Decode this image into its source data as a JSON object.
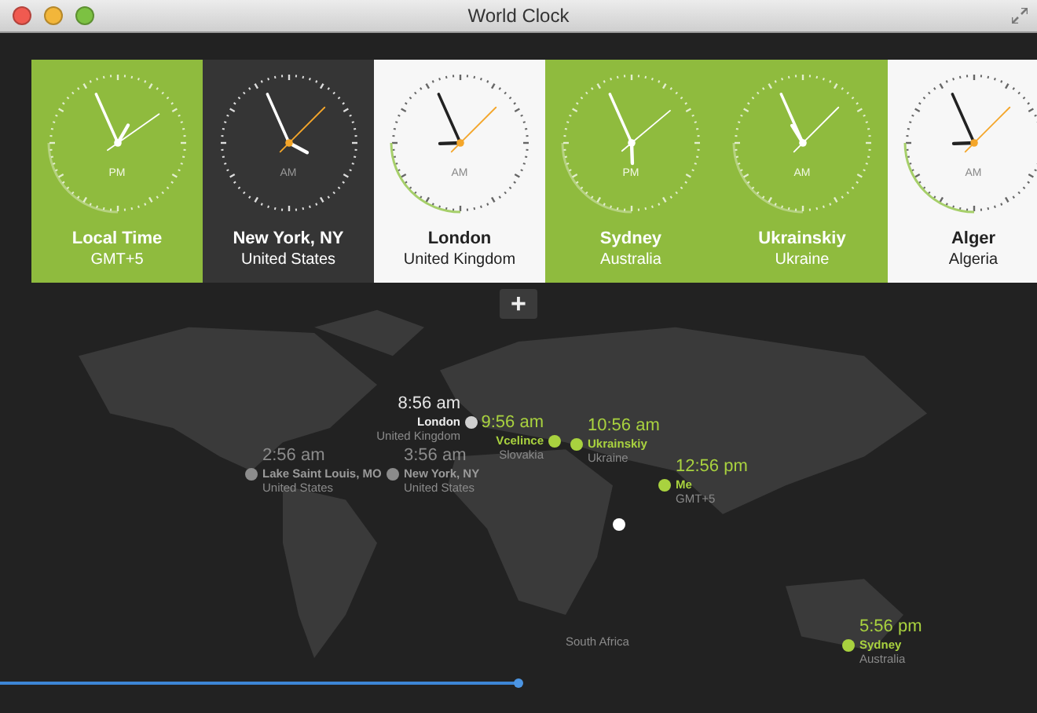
{
  "window": {
    "title": "World Clock"
  },
  "clocks": [
    {
      "kind": "green",
      "meridiem": "PM",
      "city": "Local Time",
      "country": "GMT+5"
    },
    {
      "kind": "dark",
      "meridiem": "AM",
      "city": "New York, NY",
      "country": "United States"
    },
    {
      "kind": "light",
      "meridiem": "AM",
      "city": "London",
      "country": "United Kingdom"
    },
    {
      "kind": "green",
      "meridiem": "PM",
      "city": "Sydney",
      "country": "Australia"
    },
    {
      "kind": "green",
      "meridiem": "AM",
      "city": "Ukrainskiy",
      "country": "Ukraine"
    },
    {
      "kind": "light",
      "meridiem": "AM",
      "city": "Alger",
      "country": "Algeria"
    }
  ],
  "add_button": {
    "label": "+"
  },
  "map_pins": [
    {
      "time": "8:56 am",
      "city": "London",
      "country": "United Kingdom",
      "color": "#d0d0d0"
    },
    {
      "time": "9:56 am",
      "city": "Vcelince",
      "country": "Slovakia",
      "color": "#a9d23f"
    },
    {
      "time": "10:56 am",
      "city": "Ukrainskiy",
      "country": "Ukraine",
      "color": "#a9d23f"
    },
    {
      "time": "2:56 am",
      "city": "Lake Saint Louis, MO",
      "country": "United States",
      "color": "#8c8c8c"
    },
    {
      "time": "3:56 am",
      "city": "New York, NY",
      "country": "United States",
      "color": "#8c8c8c"
    },
    {
      "time": "12:56 pm",
      "city": "Me",
      "country": "GMT+5",
      "color": "#a9d23f"
    },
    {
      "country": "South Africa"
    },
    {
      "time": "5:56 pm",
      "city": "Sydney",
      "country": "Australia",
      "color": "#a9d23f"
    }
  ],
  "time_slider": {
    "level": 0.5
  }
}
